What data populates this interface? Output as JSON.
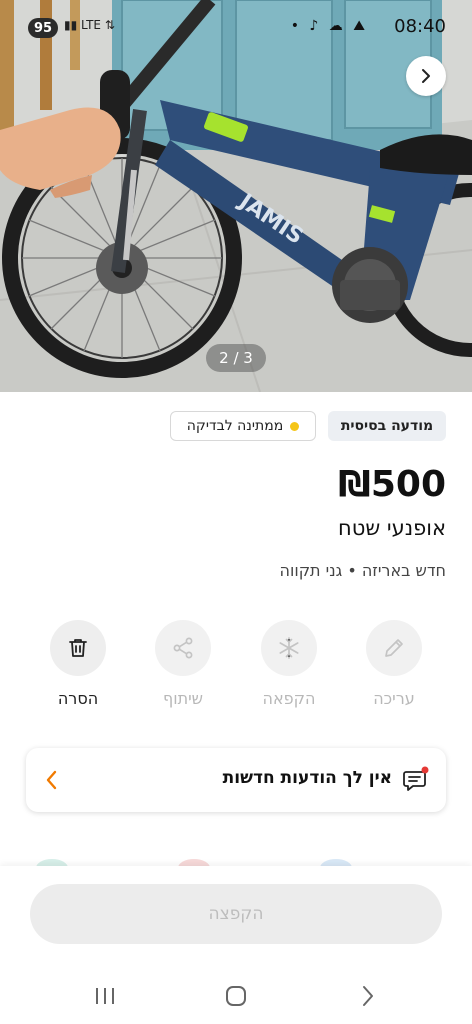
{
  "status_bar": {
    "battery": "95",
    "network_label": "LTE",
    "notif_icons": "• ♪ ☁ ⛰",
    "time": "08:40"
  },
  "gallery": {
    "pager": "2 / 3",
    "frame_brand": "JAMIS"
  },
  "listing": {
    "badge_basic": "מודעה בסיסית",
    "badge_pending": "ממתינה לבדיקה",
    "price": "₪500",
    "title": "אופנעי שטח",
    "subtitle": "חדש באריזה • גני תקווה"
  },
  "actions": [
    {
      "label": "עריכה",
      "icon": "pencil-icon",
      "active": false
    },
    {
      "label": "הקפאה",
      "icon": "snowflake-icon",
      "active": false
    },
    {
      "label": "שיתוף",
      "icon": "share-icon",
      "active": false
    },
    {
      "label": "הסרה",
      "icon": "trash-icon",
      "active": true
    }
  ],
  "messages": {
    "text": "אין לך הודעות חדשות"
  },
  "bottom": {
    "freeze_button": "הקפצה"
  },
  "colors": {
    "accent_orange": "#f07a00",
    "notification_red": "#e53935",
    "pending_dot": "#f5c518"
  }
}
